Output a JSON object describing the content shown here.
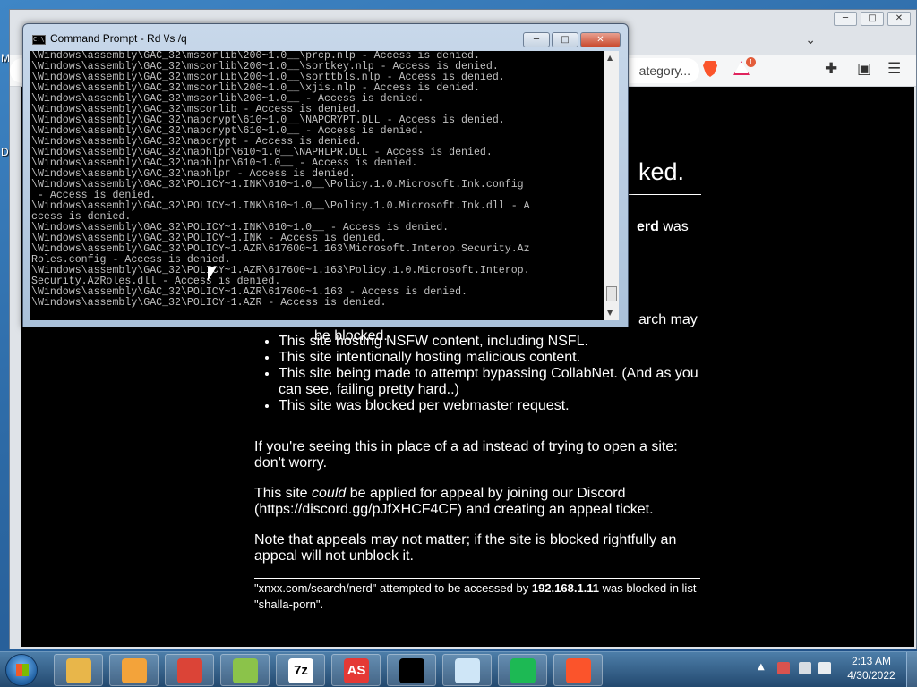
{
  "desktop": {
    "icon_labels": [
      "M",
      "D"
    ]
  },
  "browser": {
    "address_text": "ategory...",
    "rewards_badge": "1",
    "window_controls": {
      "minimize": "─",
      "maximize": "□",
      "close": "✕"
    },
    "tabs_dropdown_icon": "⌄",
    "extensions_icon": "puzzle-icon",
    "wallet_icon": "wallet-icon",
    "menu_icon": "☰"
  },
  "blocked_page": {
    "title_fragment": "ked.",
    "partial_line_1": "erd",
    "partial_line_1_suffix": " was",
    "partial_line_2": "arch may",
    "partial_line_3": "be blocked.",
    "reasons": [
      "This site hosting NSFW content, including NSFL.",
      "This site intentionally hosting malicious content.",
      "This site being made to attempt bypassing CollabNet. (And as you can see, failing pretty hard..)",
      "This site was blocked per webmaster request."
    ],
    "para_ad": "If you're seeing this in place of a ad instead of trying to open a site: don't worry.",
    "para_appeal_pre": "This site ",
    "para_appeal_em": "could",
    "para_appeal_post": " be applied for appeal by joining our Discord (https://discord.gg/pJfXHCF4CF) and creating an appeal ticket.",
    "para_note": "Note that appeals may not matter; if the site is blocked rightfully an appeal will not unblock it.",
    "footer_pre": "\"xnxx.com/search/nerd\" attempted to be accessed by ",
    "footer_ip": "192.168.1.11",
    "footer_mid": " was blocked in list \"shalla-porn\"."
  },
  "cmd": {
    "title": "Command Prompt - Rd  \\/s /q",
    "icon_text": "C:\\",
    "buttons": {
      "minimize": "─",
      "maximize": "□",
      "close": "✕"
    },
    "lines": [
      "\\Windows\\assembly\\GAC_32\\mscorlib\\200~1.0__\\prcp.nlp - Access is denied.",
      "\\Windows\\assembly\\GAC_32\\mscorlib\\200~1.0__\\sortkey.nlp - Access is denied.",
      "\\Windows\\assembly\\GAC_32\\mscorlib\\200~1.0__\\sorttbls.nlp - Access is denied.",
      "\\Windows\\assembly\\GAC_32\\mscorlib\\200~1.0__\\xjis.nlp - Access is denied.",
      "\\Windows\\assembly\\GAC_32\\mscorlib\\200~1.0__ - Access is denied.",
      "\\Windows\\assembly\\GAC_32\\mscorlib - Access is denied.",
      "\\Windows\\assembly\\GAC_32\\napcrypt\\610~1.0__\\NAPCRYPT.DLL - Access is denied.",
      "\\Windows\\assembly\\GAC_32\\napcrypt\\610~1.0__ - Access is denied.",
      "\\Windows\\assembly\\GAC_32\\napcrypt - Access is denied.",
      "\\Windows\\assembly\\GAC_32\\naphlpr\\610~1.0__\\NAPHLPR.DLL - Access is denied.",
      "\\Windows\\assembly\\GAC_32\\naphlpr\\610~1.0__ - Access is denied.",
      "\\Windows\\assembly\\GAC_32\\naphlpr - Access is denied.",
      "\\Windows\\assembly\\GAC_32\\POLICY~1.INK\\610~1.0__\\Policy.1.0.Microsoft.Ink.config",
      " - Access is denied.",
      "\\Windows\\assembly\\GAC_32\\POLICY~1.INK\\610~1.0__\\Policy.1.0.Microsoft.Ink.dll - A",
      "ccess is denied.",
      "\\Windows\\assembly\\GAC_32\\POLICY~1.INK\\610~1.0__ - Access is denied.",
      "\\Windows\\assembly\\GAC_32\\POLICY~1.INK - Access is denied.",
      "\\Windows\\assembly\\GAC_32\\POLICY~1.AZR\\617600~1.163\\Microsoft.Interop.Security.Az",
      "Roles.config - Access is denied.",
      "\\Windows\\assembly\\GAC_32\\POLICY~1.AZR\\617600~1.163\\Policy.1.0.Microsoft.Interop.",
      "Security.AzRoles.dll - Access is denied.",
      "\\Windows\\assembly\\GAC_32\\POLICY~1.AZR\\617600~1.163 - Access is denied.",
      "\\Windows\\assembly\\GAC_32\\POLICY~1.AZR - Access is denied."
    ]
  },
  "taskbar": {
    "apps": [
      {
        "name": "Windows Explorer",
        "icon": "folder-icon",
        "color": "#e8b64a"
      },
      {
        "name": "Media Player",
        "icon": "media-player-icon",
        "color": "#f3a33a"
      },
      {
        "name": "Google Chrome",
        "icon": "chrome-icon",
        "color": "#db4437"
      },
      {
        "name": "Notepad++",
        "icon": "notepadpp-icon",
        "color": "#8bc34a"
      },
      {
        "name": "7-Zip",
        "icon": "7z-icon",
        "label": "7z",
        "color": "#ffffff"
      },
      {
        "name": "AS",
        "icon": "as-icon",
        "label": "AS",
        "color": "#e53935"
      },
      {
        "name": "Command Prompt",
        "icon": "cmd-icon",
        "color": "#000000"
      },
      {
        "name": "Notepad",
        "icon": "notepad-icon",
        "color": "#cfe6f7"
      },
      {
        "name": "Spotify-like",
        "icon": "audio-icon",
        "color": "#1db954"
      },
      {
        "name": "Brave",
        "icon": "brave-icon",
        "color": "#fb542b"
      }
    ],
    "clock_time": "2:13 AM",
    "clock_date": "4/30/2022",
    "tray_arrow": "▲"
  }
}
